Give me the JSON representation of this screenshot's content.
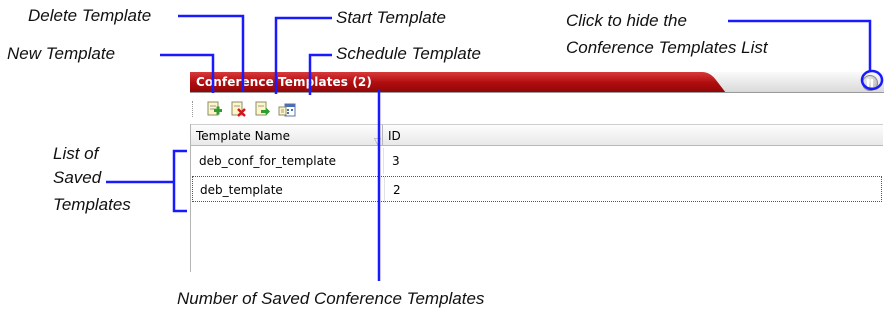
{
  "callouts": {
    "delete_template": "Delete Template",
    "start_template": "Start Template",
    "new_template": "New Template",
    "schedule_template": "Schedule Template",
    "hide_list_line1": "Click to hide the",
    "hide_list_line2": "Conference Templates List",
    "saved_list_line1": "List of",
    "saved_list_line2": "Saved",
    "saved_list_line3": "Templates",
    "count_caption": "Number of Saved Conference Templates"
  },
  "panel": {
    "title": "Conference Templates (2)",
    "titlebar_color": "#b10d10",
    "callout_line_color": "#1a1aff"
  },
  "toolbar": {
    "buttons": [
      {
        "icon": "new-template-icon"
      },
      {
        "icon": "delete-template-icon"
      },
      {
        "icon": "start-template-icon"
      },
      {
        "icon": "schedule-template-icon"
      }
    ]
  },
  "table": {
    "columns": [
      "Template Name",
      "ID"
    ],
    "rows": [
      {
        "name": "deb_conf_for_template",
        "id": "3"
      },
      {
        "name": "deb_template",
        "id": "2"
      }
    ]
  }
}
